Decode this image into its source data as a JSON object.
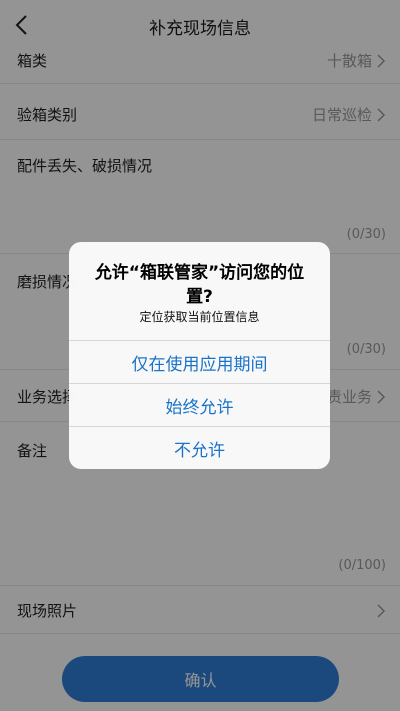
{
  "nav": {
    "title": "补充现场信息"
  },
  "form": {
    "box_type": {
      "label": "箱类",
      "value": "十散箱"
    },
    "inspection_type": {
      "label": "验箱类别",
      "value": "日常巡检"
    },
    "parts_lost": {
      "label": "配件丢失、破损情况",
      "counter": "(0/30)"
    },
    "wear": {
      "label": "磨损情况",
      "counter": "(0/30)"
    },
    "business": {
      "label": "业务选择",
      "value": "责业务"
    },
    "remark": {
      "label": "备注",
      "counter": "(0/100)"
    },
    "photos": {
      "label": "现场照片"
    }
  },
  "footer": {
    "confirm_label": "确认"
  },
  "alert": {
    "title": "允许“箱联管家”访问您的位置?",
    "message": "定位获取当前位置信息",
    "buttons": {
      "while_using": "仅在使用应用期间",
      "always": "始终允许",
      "deny": "不允许"
    }
  },
  "colors": {
    "accent": "#2f7fd9",
    "link": "#1a73c9"
  }
}
